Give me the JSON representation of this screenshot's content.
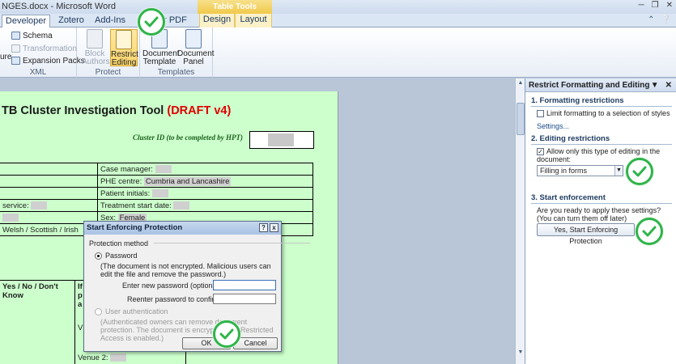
{
  "window": {
    "title": "NGES.docx - Microsoft Word",
    "context_tab_group": "Table Tools"
  },
  "tabs": [
    "Developer",
    "Zotero",
    "Add-Ins",
    "er PDF",
    "Design",
    "Layout"
  ],
  "ribbon": {
    "left_clip": "ure",
    "xml_group": {
      "label": "XML",
      "items": [
        "Schema",
        "Transformation",
        "Expansion Packs"
      ]
    },
    "protect_group": {
      "label": "Protect",
      "block_authors": "Block Authors",
      "restrict_editing": "Restrict Editing"
    },
    "templates_group": {
      "label": "Templates",
      "document_template": "Document Template",
      "document_panel": "Document Panel"
    }
  },
  "document": {
    "title_prefix": "TB Cluster Investigation Tool ",
    "title_draft": "(DRAFT v4)",
    "cluster_label": "Cluster ID (to be completed by HPT)",
    "rows": [
      {
        "left": "",
        "right_label": "Case manager:",
        "right_value": ""
      },
      {
        "left": "",
        "right_label": "PHE centre:",
        "right_value": "Cumbria and Lancashire"
      },
      {
        "left": "",
        "right_label": "Patient initials:",
        "right_value": ""
      },
      {
        "left": "service:",
        "right_label": "Treatment start date:",
        "right_value": ""
      },
      {
        "left": "",
        "right_label": "Sex:",
        "right_value": "Female"
      },
      {
        "left": "Welsh / Scottish / Irish",
        "right_label": "",
        "right_value": ""
      }
    ],
    "lower": {
      "yes_no": "Yes / No / Don't Know",
      "col2_fragment": [
        "If",
        "p",
        "a"
      ],
      "v_fragment": "V",
      "venue2": "Venue 2:"
    }
  },
  "task_pane": {
    "title": "Restrict Formatting and Editing",
    "section1": "1. Formatting restrictions",
    "limit_formatting": "Limit formatting to a selection of styles",
    "settings_link": "Settings...",
    "section2": "2. Editing restrictions",
    "allow_only": "Allow only this type of editing in the document:",
    "editing_type": "Filling in forms",
    "section3": "3. Start enforcement",
    "question": "Are you ready to apply these settings? (You can turn them off later)",
    "enforce_button": "Yes, Start Enforcing Protection"
  },
  "dialog": {
    "title": "Start Enforcing Protection",
    "help": "?",
    "close": "x",
    "protection_method": "Protection method",
    "password_option": "Password",
    "password_desc": "(The document is not encrypted. Malicious users can edit the file and remove the password.)",
    "new_password_label": "Enter new password (optional):",
    "reenter_label": "Reenter password to confirm:",
    "user_auth_option": "User authentication",
    "user_auth_desc": "(Authenticated owners can remove document protection. The document is encrypted and Restricted Access is enabled.)",
    "ok": "OK",
    "cancel": "Cancel"
  },
  "colors": {
    "page_background": "#ccffcc",
    "draft_red": "#e00000",
    "check_green": "#2fb44a"
  }
}
